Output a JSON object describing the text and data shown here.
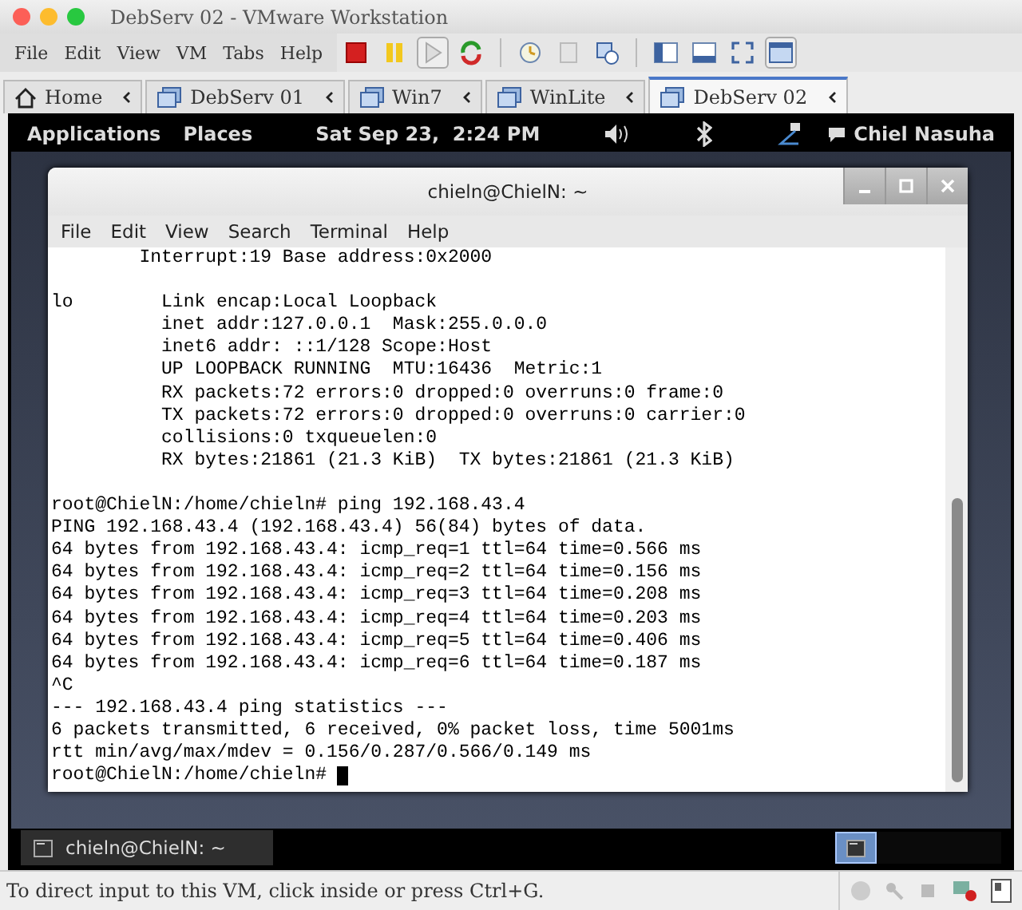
{
  "window": {
    "title": "DebServ 02 - VMware Workstation"
  },
  "menu": [
    "File",
    "Edit",
    "View",
    "VM",
    "Tabs",
    "Help"
  ],
  "tabs": [
    {
      "label": "Home",
      "kind": "home",
      "selected": false
    },
    {
      "label": "DebServ 01",
      "kind": "vm",
      "selected": false
    },
    {
      "label": "Win7",
      "kind": "vm",
      "selected": false
    },
    {
      "label": "WinLite",
      "kind": "vm",
      "selected": false
    },
    {
      "label": "DebServ 02",
      "kind": "vm",
      "selected": true
    }
  ],
  "guest": {
    "panel": {
      "menus": [
        "Applications",
        "Places"
      ],
      "clock": "Sat Sep 23,  2:24 PM",
      "user": "Chiel Nasuha"
    },
    "terminal": {
      "title": "chieln@ChielN: ~",
      "menu": [
        "File",
        "Edit",
        "View",
        "Search",
        "Terminal",
        "Help"
      ],
      "blocks": [
        [
          "        Interrupt:19 Base address:0x2000"
        ],
        [
          "lo        Link encap:Local Loopback",
          "          inet addr:127.0.0.1  Mask:255.0.0.0",
          "          inet6 addr: ::1/128 Scope:Host",
          "          UP LOOPBACK RUNNING  MTU:16436  Metric:1",
          "          RX packets:72 errors:0 dropped:0 overruns:0 frame:0",
          "          TX packets:72 errors:0 dropped:0 overruns:0 carrier:0",
          "          collisions:0 txqueuelen:0",
          "          RX bytes:21861 (21.3 KiB)  TX bytes:21861 (21.3 KiB)"
        ],
        [
          "root@ChielN:/home/chieln# ping 192.168.43.4",
          "PING 192.168.43.4 (192.168.43.4) 56(84) bytes of data.",
          "64 bytes from 192.168.43.4: icmp_req=1 ttl=64 time=0.566 ms",
          "64 bytes from 192.168.43.4: icmp_req=2 ttl=64 time=0.156 ms",
          "64 bytes from 192.168.43.4: icmp_req=3 ttl=64 time=0.208 ms",
          "64 bytes from 192.168.43.4: icmp_req=4 ttl=64 time=0.203 ms",
          "64 bytes from 192.168.43.4: icmp_req=5 ttl=64 time=0.406 ms",
          "64 bytes from 192.168.43.4: icmp_req=6 ttl=64 time=0.187 ms",
          "^C",
          "--- 192.168.43.4 ping statistics ---",
          "6 packets transmitted, 6 received, 0% packet loss, time 5001ms",
          "rtt min/avg/max/mdev = 0.156/0.287/0.566/0.149 ms",
          "root@ChielN:/home/chieln# "
        ]
      ]
    },
    "taskbar": [
      {
        "label": "chieln@ChielN: ~"
      }
    ]
  },
  "status_bar": {
    "text": "To direct input to this VM, click inside or press Ctrl+G."
  }
}
